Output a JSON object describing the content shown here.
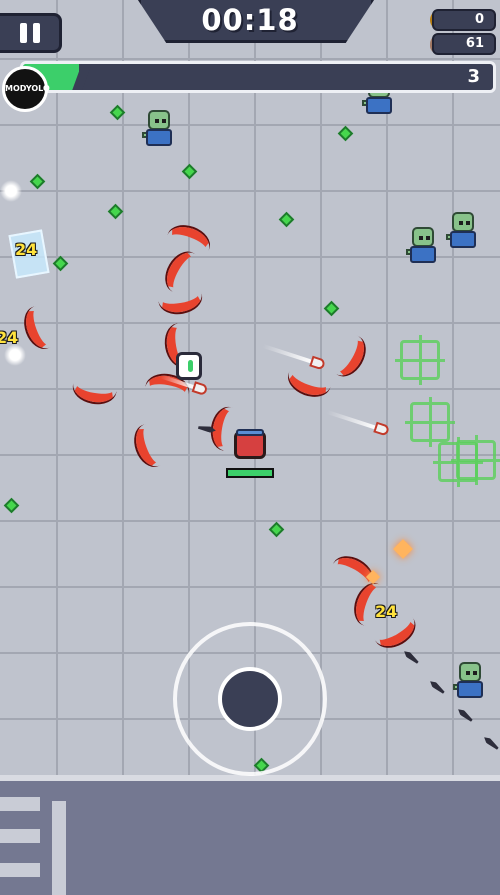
{
  "hud": {
    "timer": "00:18",
    "coins": "0",
    "kills": "61",
    "level": "3",
    "xp_progress": 0.12,
    "badge_text": "MODYOLO",
    "player_hp": 1.0
  },
  "damage_numbers": [
    "24",
    "24",
    "24"
  ],
  "icons": {
    "pause": "pause-icon",
    "coin": "coin-icon",
    "kills": "skull-icon"
  },
  "colors": {
    "hud_bg": "#3a3f55",
    "xp_fill": "#3ccf6a",
    "gem": "#46d64d",
    "boomerang": "#e8432e",
    "damage_text": "#ffe23d"
  }
}
